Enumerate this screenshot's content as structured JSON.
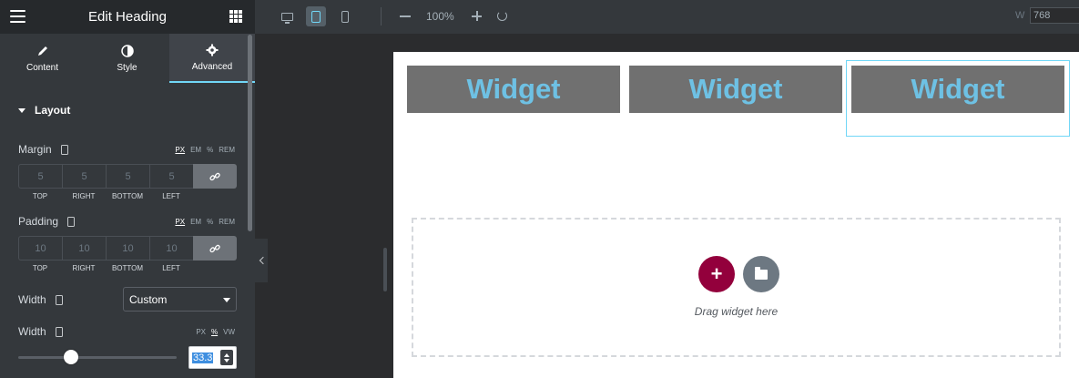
{
  "panel": {
    "title": "Edit Heading",
    "tabs": [
      {
        "label": "Content",
        "icon": "pencil-icon"
      },
      {
        "label": "Style",
        "icon": "contrast-icon"
      },
      {
        "label": "Advanced",
        "icon": "gear-icon",
        "active": true
      }
    ],
    "section": "Layout",
    "margin": {
      "label": "Margin",
      "units": [
        "PX",
        "EM",
        "%",
        "REM"
      ],
      "selected_unit": "PX",
      "values": [
        "5",
        "5",
        "5",
        "5"
      ],
      "sides": [
        "TOP",
        "RIGHT",
        "BOTTOM",
        "LEFT"
      ]
    },
    "padding": {
      "label": "Padding",
      "units": [
        "PX",
        "EM",
        "%",
        "REM"
      ],
      "selected_unit": "PX",
      "values": [
        "10",
        "10",
        "10",
        "10"
      ],
      "sides": [
        "TOP",
        "RIGHT",
        "BOTTOM",
        "LEFT"
      ]
    },
    "width_mode": {
      "label": "Width",
      "value": "Custom"
    },
    "width_value": {
      "label": "Width",
      "units": [
        "PX",
        "%",
        "VW"
      ],
      "selected_unit": "%",
      "value": "33.3",
      "slider_fraction": 0.333
    }
  },
  "toolbar": {
    "devices": [
      "desktop-icon",
      "tablet-icon",
      "mobile-icon"
    ],
    "active_device": "tablet",
    "zoom": "100%",
    "width_label": "W",
    "width_value": "768"
  },
  "canvas": {
    "widgets": [
      "Widget",
      "Widget",
      "Widget"
    ],
    "drop_text": "Drag widget here",
    "add_symbol": "+"
  },
  "colors": {
    "accent": "#71d7f7",
    "widget_bg": "#707070",
    "widget_text": "#6ec1e4",
    "add_button": "#93003c"
  }
}
